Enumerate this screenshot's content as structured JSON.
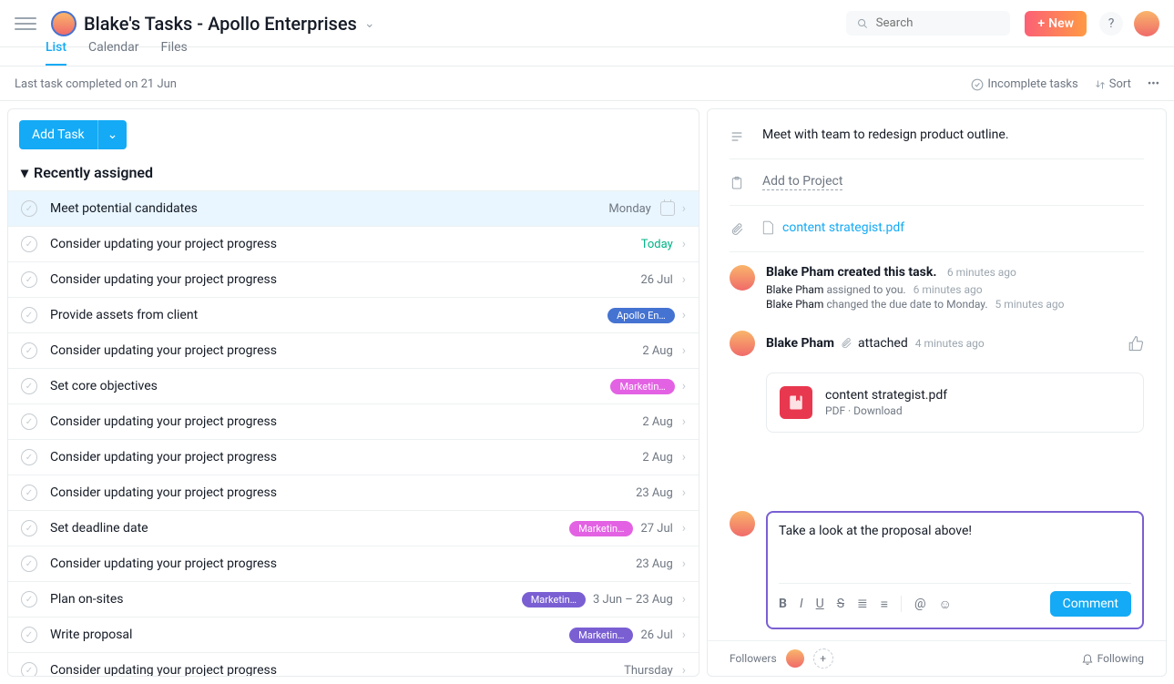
{
  "header": {
    "title": "Blake's Tasks - Apollo Enterprises",
    "search_placeholder": "Search",
    "new_label": "New",
    "help_label": "?"
  },
  "tabs": {
    "list": "List",
    "calendar": "Calendar",
    "files": "Files"
  },
  "subbar": {
    "last_completed": "Last task completed on 21 Jun",
    "filter": "Incomplete tasks",
    "sort": "Sort"
  },
  "main": {
    "add_task": "Add Task",
    "section_title": "Recently assigned",
    "tasks": [
      {
        "title": "Meet potential candidates",
        "meta": "Monday",
        "selected": true,
        "show_cal": true
      },
      {
        "title": "Consider updating your project progress",
        "meta": "Today",
        "today": true
      },
      {
        "title": "Consider updating your project progress",
        "meta": "26 Jul"
      },
      {
        "title": "Provide assets from client",
        "pill": {
          "text": "Apollo En…",
          "color": "#4573d2"
        }
      },
      {
        "title": "Consider updating your project progress",
        "meta": "2 Aug"
      },
      {
        "title": "Set core objectives",
        "pill": {
          "text": "Marketin…",
          "color": "#e362e3"
        }
      },
      {
        "title": "Consider updating your project progress",
        "meta": "2 Aug"
      },
      {
        "title": "Consider updating your project progress",
        "meta": "2 Aug"
      },
      {
        "title": "Consider updating your project progress",
        "meta": "23 Aug"
      },
      {
        "title": "Set deadline date",
        "pill": {
          "text": "Marketin…",
          "color": "#e362e3"
        },
        "meta": "27 Jul"
      },
      {
        "title": "Consider updating your project progress",
        "meta": "23 Aug"
      },
      {
        "title": "Plan on-sites",
        "pill": {
          "text": "Marketin…",
          "color": "#7a5fd3"
        },
        "meta": "3 Jun – 23 Aug"
      },
      {
        "title": "Write proposal",
        "pill": {
          "text": "Marketin…",
          "color": "#7a5fd3"
        },
        "meta": "26 Jul"
      },
      {
        "title": "Consider updating your project progress",
        "meta": "Thursday"
      }
    ]
  },
  "detail": {
    "description": "Meet with team to redesign product outline.",
    "add_to_project": "Add to Project",
    "attachment_name": "content strategist.pdf",
    "activity": {
      "created_by": "Blake Pham created this task.",
      "created_ago": "6 minutes ago",
      "sub1_a": "Blake Pham",
      "sub1_b": " assigned to you.",
      "sub1_ago": "6 minutes ago",
      "sub2_a": "Blake Pham",
      "sub2_b": " changed the due date to Monday.",
      "sub2_ago": "5 minutes ago",
      "attached_by": "Blake Pham",
      "attached_word": "attached",
      "attached_ago": "4 minutes ago"
    },
    "attach_card": {
      "name": "content strategist.pdf",
      "type": "PDF",
      "download": "Download"
    },
    "comment_text": "Take a look at the proposal above!",
    "comment_button": "Comment",
    "followers_label": "Followers",
    "following_label": "Following"
  }
}
